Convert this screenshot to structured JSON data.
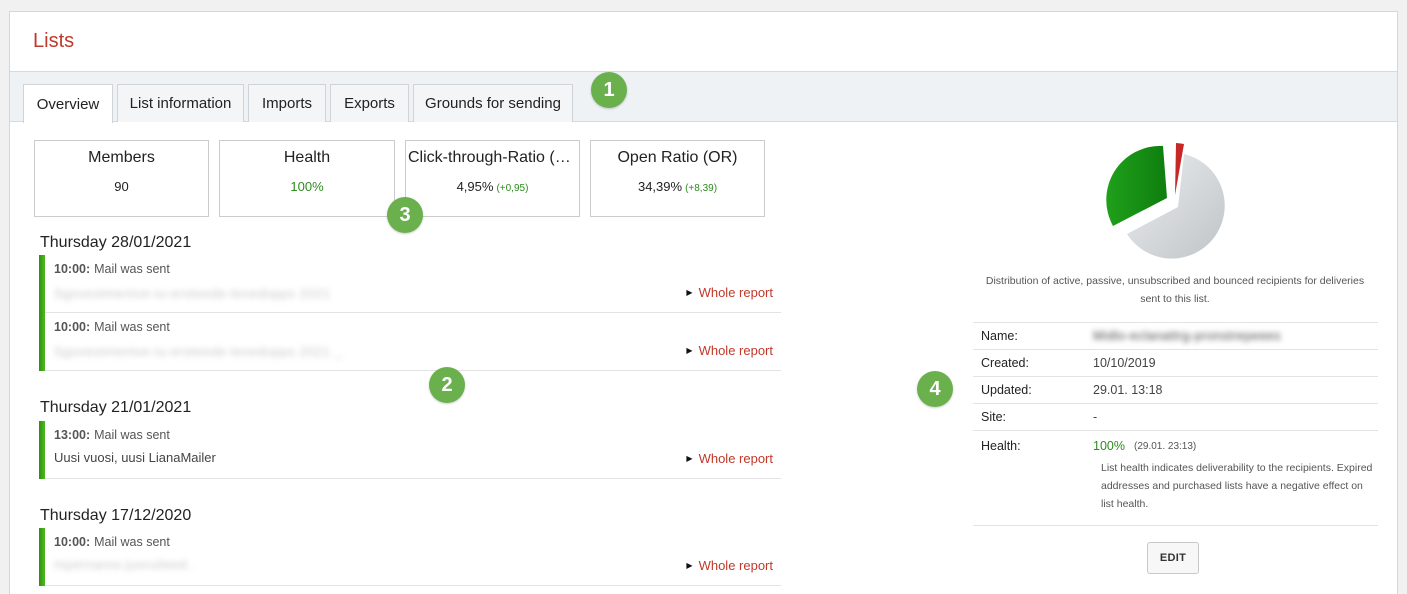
{
  "panel": {
    "title": "Lists"
  },
  "tabs": [
    {
      "label": "Overview",
      "active": true
    },
    {
      "label": "List information",
      "active": false
    },
    {
      "label": "Imports",
      "active": false
    },
    {
      "label": "Exports",
      "active": false
    },
    {
      "label": "Grounds for sending",
      "active": false
    }
  ],
  "callouts": [
    "1",
    "2",
    "3",
    "4"
  ],
  "stats": [
    {
      "title": "Members",
      "value": "90"
    },
    {
      "title": "Health",
      "value": "100%"
    },
    {
      "title": "Click-through-Ratio (CTR)",
      "value": "4,95%",
      "delta": "(+0,95)"
    },
    {
      "title": "Open Ratio (OR)",
      "value": "34,39%",
      "delta": "(+8,39)"
    }
  ],
  "timeline": [
    {
      "day": "Thursday 28/01/2021",
      "events": [
        {
          "time": "10:00:",
          "action": "Mail was sent",
          "subject": "Sgovestmentve-iu-eroteede-lenedopps 2021",
          "link": "Whole report"
        },
        {
          "time": "10:00:",
          "action": "Mail was sent",
          "subject": "Sgovestmentve-iu-eroteede-lenedopps 2021 _",
          "link": "Whole report"
        }
      ]
    },
    {
      "day": "Thursday 21/01/2021",
      "events": [
        {
          "time": "13:00:",
          "action": "Mail was sent",
          "subject": "Uusi vuosi, uusi LianaMailer",
          "link": "Whole report"
        }
      ]
    },
    {
      "day": "Thursday 17/12/2020",
      "events": [
        {
          "time": "10:00:",
          "action": "Mail was sent",
          "subject": "Inpernaros-juoruileed  .",
          "link": "Whole report"
        }
      ]
    }
  ],
  "distribution": {
    "caption": "Distribution of active, passive, unsubscribed and bounced recipients for deliveries sent to this list.",
    "colors": {
      "active": "#1fa01a",
      "passive": "#cfd3d6",
      "unsubscribed": "#c62828"
    }
  },
  "info": {
    "rows": [
      {
        "label": "Name:",
        "value": "Midlo-eclanattrg-pronstrepeees"
      },
      {
        "label": "Created:",
        "value": "10/10/2019"
      },
      {
        "label": "Updated:",
        "value": "29.01. 13:18"
      },
      {
        "label": "Site:",
        "value": "-"
      }
    ],
    "health_label": "Health:",
    "health_value": "100%",
    "health_time": "(29.01. 23:13)",
    "health_note": "List health indicates deliverability to the recipients. Expired addresses and purchased lists have a negative effect on list health."
  },
  "edit_button": "EDIT"
}
